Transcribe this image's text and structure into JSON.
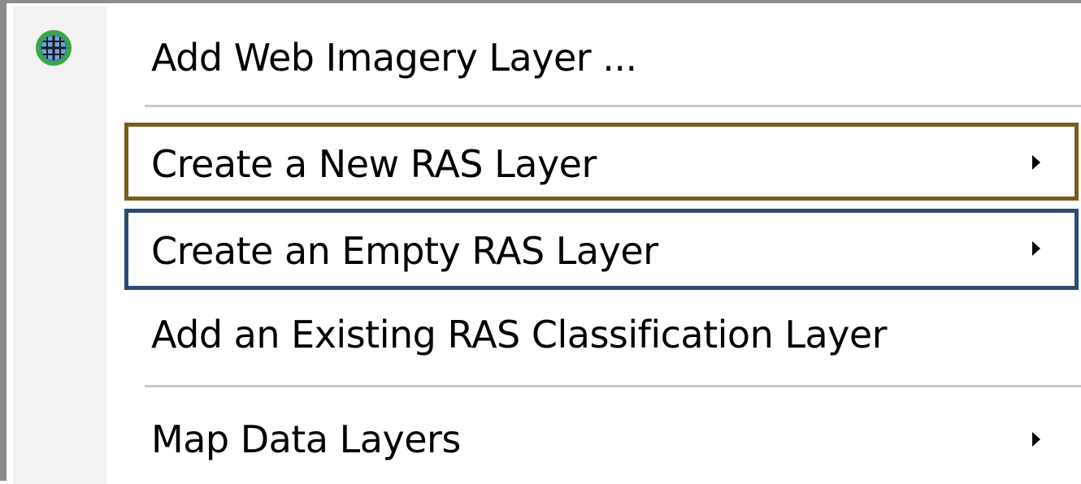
{
  "menu": {
    "items": [
      {
        "label": "Add Web Imagery Layer ...",
        "icon": "globe-icon",
        "has_submenu": false
      },
      {
        "label": "Create a New RAS Layer",
        "has_submenu": true,
        "highlight_color": "#7a5c1a"
      },
      {
        "label": "Create an Empty RAS Layer",
        "has_submenu": true,
        "highlight_color": "#2a4d70"
      },
      {
        "label": "Add an Existing RAS Classification Layer",
        "has_submenu": false
      },
      {
        "label": "Map Data Layers",
        "has_submenu": true
      }
    ]
  },
  "colors": {
    "frame_border": "#8c8c8c",
    "gutter": "#f2f2f2",
    "separator": "#c8c8c8",
    "globe_outline": "#3aa54a",
    "globe_fill": "#2f6fc0"
  }
}
